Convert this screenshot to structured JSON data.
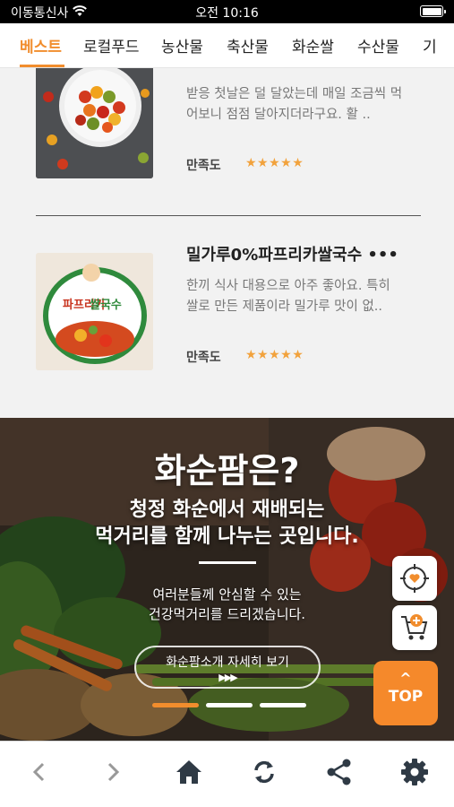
{
  "status": {
    "carrier": "이동통신사",
    "time": "오전 10:16"
  },
  "tabs": [
    "베스트",
    "로컬푸드",
    "농산물",
    "축산물",
    "화순쌀",
    "수산물",
    "기"
  ],
  "reviews": [
    {
      "title": "",
      "text_line1": "받응 첫날은 덜 달았는데 매일 조금씩 먹",
      "text_line2": "어보니 점점 달아지더라구요. 활 ..",
      "satisfaction_label": "만족도",
      "rating": 5,
      "stars": "★★★★★"
    },
    {
      "title": "밀가루0%파프리카쌀국수 •••",
      "text_line1": "한끼 식사 대용으로 아주 좋아요. 특히",
      "text_line2": "쌀로 만든 제품이라 밀가루 맛이 없..",
      "satisfaction_label": "만족도",
      "rating": 5,
      "stars": "★★★★★"
    }
  ],
  "banner": {
    "title": "화순팜은?",
    "sub1": "청정 화순에서 재배되는",
    "sub2": "먹거리를 함께 나누는 곳입니다.",
    "small1": "여러분들께 안심할 수 있는",
    "small2": "건강먹거리를 드리겠습니다.",
    "button_label": "화순팜소개 자세히 보기",
    "button_arrows": "▶▶▶",
    "slide_count": 3,
    "active_slide": 1
  },
  "floating": {
    "top_label": "TOP",
    "top_caret": "^"
  },
  "bottom_nav": [
    "back-icon",
    "forward-icon",
    "home-icon",
    "refresh-icon",
    "share-icon",
    "settings-icon"
  ],
  "colors": {
    "accent": "#f18d2d",
    "top_button": "#f5892b",
    "stars": "#f2a23c"
  }
}
